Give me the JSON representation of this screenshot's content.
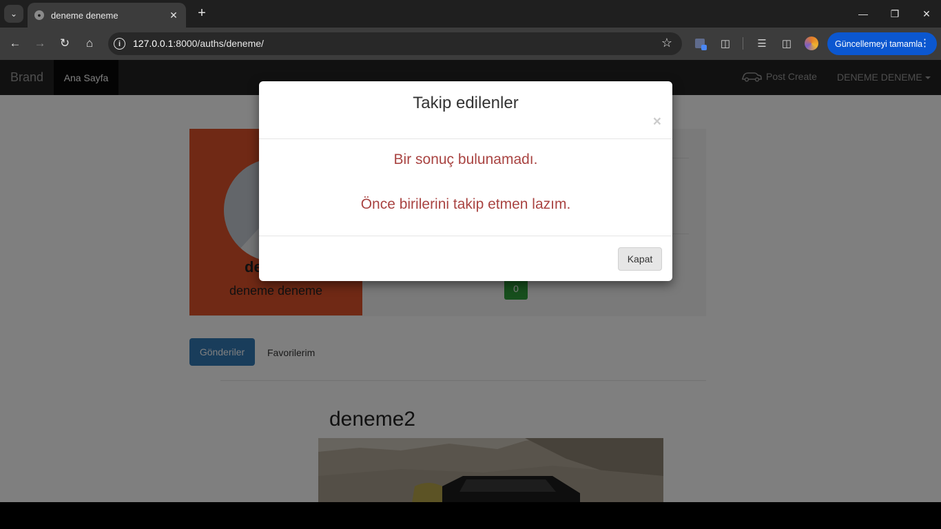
{
  "browser": {
    "tab_title": "deneme deneme",
    "url_host": "127.0.0.1",
    "url_rest": ":8000/auths/deneme/",
    "update_button": "Güncellemeyi tamamla"
  },
  "navbar": {
    "brand": "Brand",
    "home": "Ana Sayfa",
    "post_create": "Post Create",
    "user_menu": "DENEME DENEME"
  },
  "profile": {
    "username_bold": "de",
    "full_name": "deneme deneme",
    "count": "0",
    "card_color": "#e0522b"
  },
  "tabs": {
    "sent": "Gönderiler",
    "favorites": "Favorilerim"
  },
  "post": {
    "title": "deneme2"
  },
  "modal": {
    "title": "Takip edilenler",
    "close_symbol": "×",
    "message_1": "Bir sonuç bulunamadı.",
    "message_2": "Önce birilerini takip etmen lazım.",
    "close_button": "Kapat",
    "message_color": "#a94442"
  }
}
